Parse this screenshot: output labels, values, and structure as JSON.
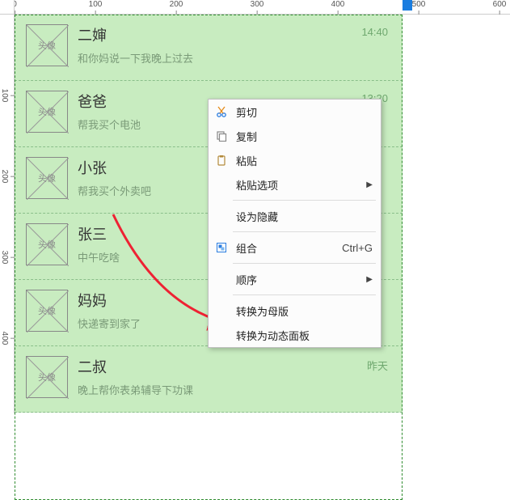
{
  "ruler": {
    "h": [
      "0",
      "100",
      "200",
      "300",
      "400",
      "500",
      "600"
    ],
    "v": [
      "100",
      "200",
      "300",
      "400"
    ]
  },
  "avatar_placeholder": "头像",
  "chat": [
    {
      "name": "二婶",
      "msg": "和你妈说一下我晚上过去",
      "time": "14:40"
    },
    {
      "name": "爸爸",
      "msg": "帮我买个电池",
      "time": "13:20"
    },
    {
      "name": "小张",
      "msg": "帮我买个外卖吧",
      "time": ""
    },
    {
      "name": "张三",
      "msg": "中午吃啥",
      "time": ""
    },
    {
      "name": "妈妈",
      "msg": "快递寄到家了",
      "time": ""
    },
    {
      "name": "二叔",
      "msg": "晚上帮你表弟辅导下功课",
      "time": "昨天"
    }
  ],
  "menu": {
    "cut": "剪切",
    "copy": "复制",
    "paste": "粘贴",
    "paste_options": "粘贴选项",
    "set_hidden": "设为隐藏",
    "group": "组合",
    "group_shortcut": "Ctrl+G",
    "order": "顺序",
    "to_master": "转换为母版",
    "to_dynamic": "转换为动态面板"
  }
}
